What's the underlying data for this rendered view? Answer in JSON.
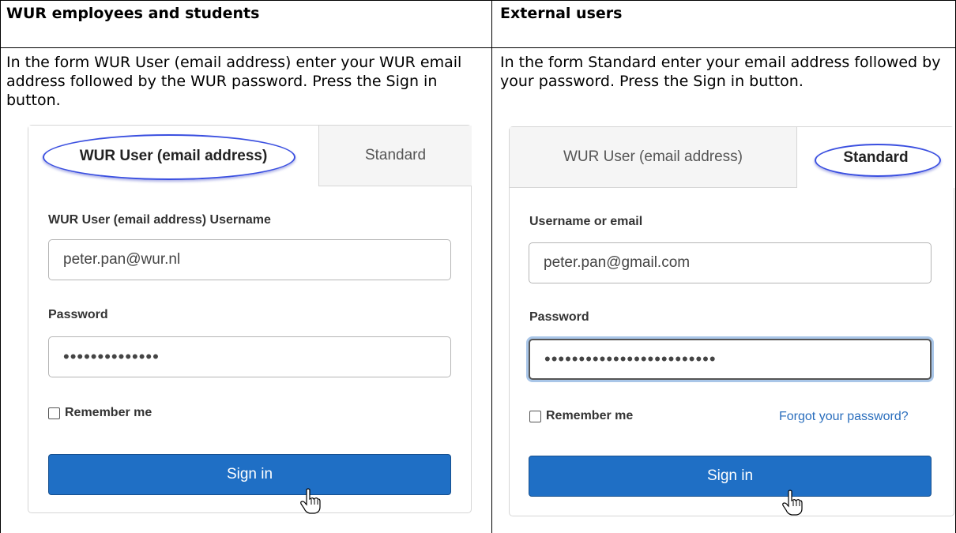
{
  "left": {
    "header": "WUR employees and students",
    "description": "In the  form WUR User (email address)  enter your WUR email address  followed by  the WUR password. Press the Sign in button.",
    "tab_active": "WUR User (email address)",
    "tab_inactive": "Standard",
    "username_label": "WUR User (email address) Username",
    "username_value": "peter.pan@wur.nl",
    "password_label": "Password",
    "password_value": "••••••••••••••",
    "remember_label": "Remember me",
    "signin_label": "Sign in"
  },
  "right": {
    "header": "External users",
    "description": "In the form Standard enter your email address followed by your password. Press the Sign in button.",
    "tab_inactive": "WUR User (email address)",
    "tab_active": "Standard",
    "username_label": "Username or email",
    "username_value": "peter.pan@gmail.com",
    "password_label": "Password",
    "password_value": "•••••••••••••••••••••••••",
    "remember_label": "Remember me",
    "forgot_label": "Forgot your password?",
    "signin_label": "Sign in"
  },
  "icons": {
    "cursor": "hand-pointer-icon",
    "highlight": "highlight-ellipse"
  },
  "colors": {
    "primary_button": "#1f6fc5",
    "link": "#2a6ebd",
    "highlight": "#3a4fe0",
    "focus_ring": "#a9c6e8"
  }
}
